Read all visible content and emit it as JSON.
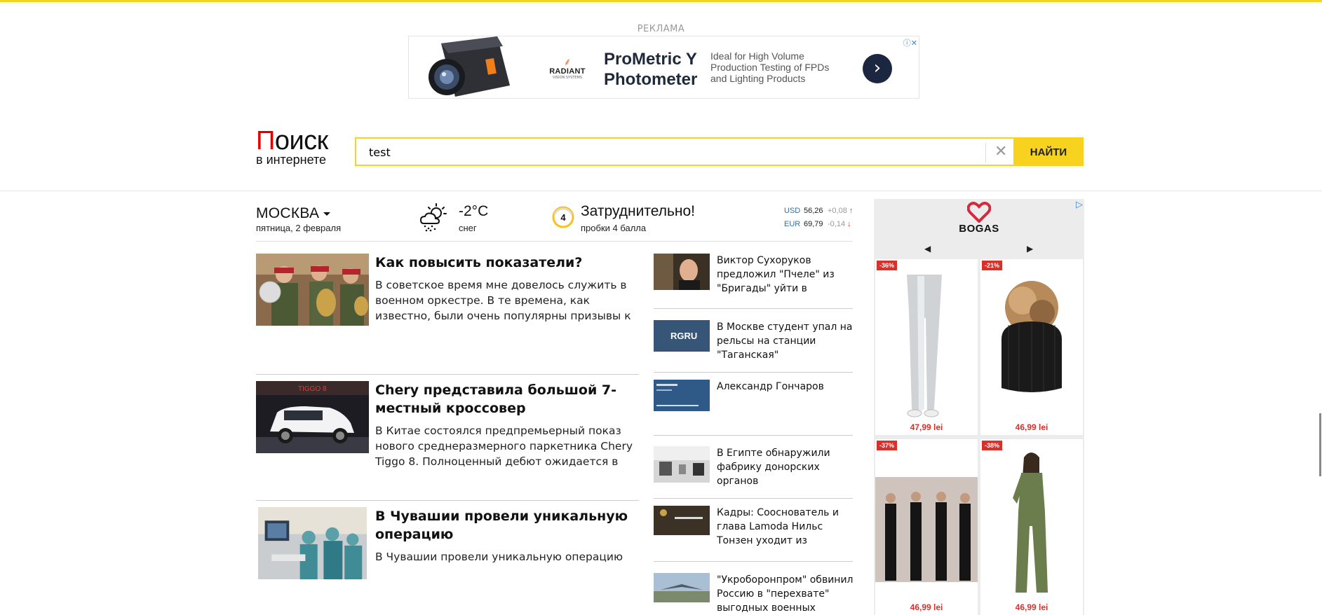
{
  "ad_label": "РЕКЛАМА",
  "ad": {
    "brand": "RADIANT",
    "brand_sub": "VISION SYSTEMS",
    "title": "ProMetric Y Photometer",
    "description": "Ideal for High Volume Production Testing of FPDs and Lighting Products",
    "go_icon": "chevron-right-icon",
    "info_icon": "adchoices-icon"
  },
  "logo": {
    "first_letter": "П",
    "rest": "оиск",
    "tagline": "в интернете"
  },
  "search": {
    "value": "test",
    "button_label": "НАЙТИ",
    "clear_icon": "close-icon"
  },
  "info": {
    "city": "МОСКВА",
    "date": "пятница, 2 февраля",
    "weather": {
      "temp": "-2°C",
      "desc": "снег",
      "icon": "snow-cloud-icon"
    },
    "traffic": {
      "level": "4",
      "title": "Затруднительно!",
      "desc": "пробки 4 балла"
    },
    "rates": [
      {
        "currency": "USD",
        "value": "56,26",
        "change": "+0,08",
        "arrow": "↑"
      },
      {
        "currency": "EUR",
        "value": "69,79",
        "change": "-0,14",
        "arrow": "↓"
      }
    ]
  },
  "main_news": [
    {
      "title": "Как повысить показатели?",
      "desc": "В советское время мне довелось служить в военном оркестре. В те времена, как известно, были очень популярны призывы к"
    },
    {
      "title": "Chery представила большой 7-местный кроссовер",
      "desc": "В Китае состоялся предпремьерный показ нового среднеразмерного паркетника Chery Tiggo 8. Полноценный дебют ожидается в"
    },
    {
      "title": "В Чувашии провели уникальную операцию",
      "desc": "В Чувашии провели уникальную операцию"
    }
  ],
  "side_news": [
    {
      "title": "Виктор Сухоруков предложил \"Пчеле\" из \"Бригады\" уйти в"
    },
    {
      "title": "В Москве студент упал на рельсы на станции \"Таганская\"",
      "thumb_text": "RGRU"
    },
    {
      "title": "Александр Гончаров"
    },
    {
      "title": "В Египте обнаружили фабрику донорских органов"
    },
    {
      "title": "Кадры: Сооснователь и глава Lamoda Нильс Тонзен уходит из"
    },
    {
      "title": "\"Укроборонпром\" обвинил Россию в \"перехвате\" выгодных военных"
    }
  ],
  "right_ad": {
    "brand": "BOGAS",
    "badge_icon": "adchoices-icon",
    "products": [
      {
        "discount": "-36%",
        "price": "47,99 lei"
      },
      {
        "discount": "-21%",
        "price": "46,99 lei"
      },
      {
        "discount": "-37%",
        "price": "46,99 lei"
      },
      {
        "discount": "-38%",
        "price": "46,99 lei"
      }
    ]
  }
}
